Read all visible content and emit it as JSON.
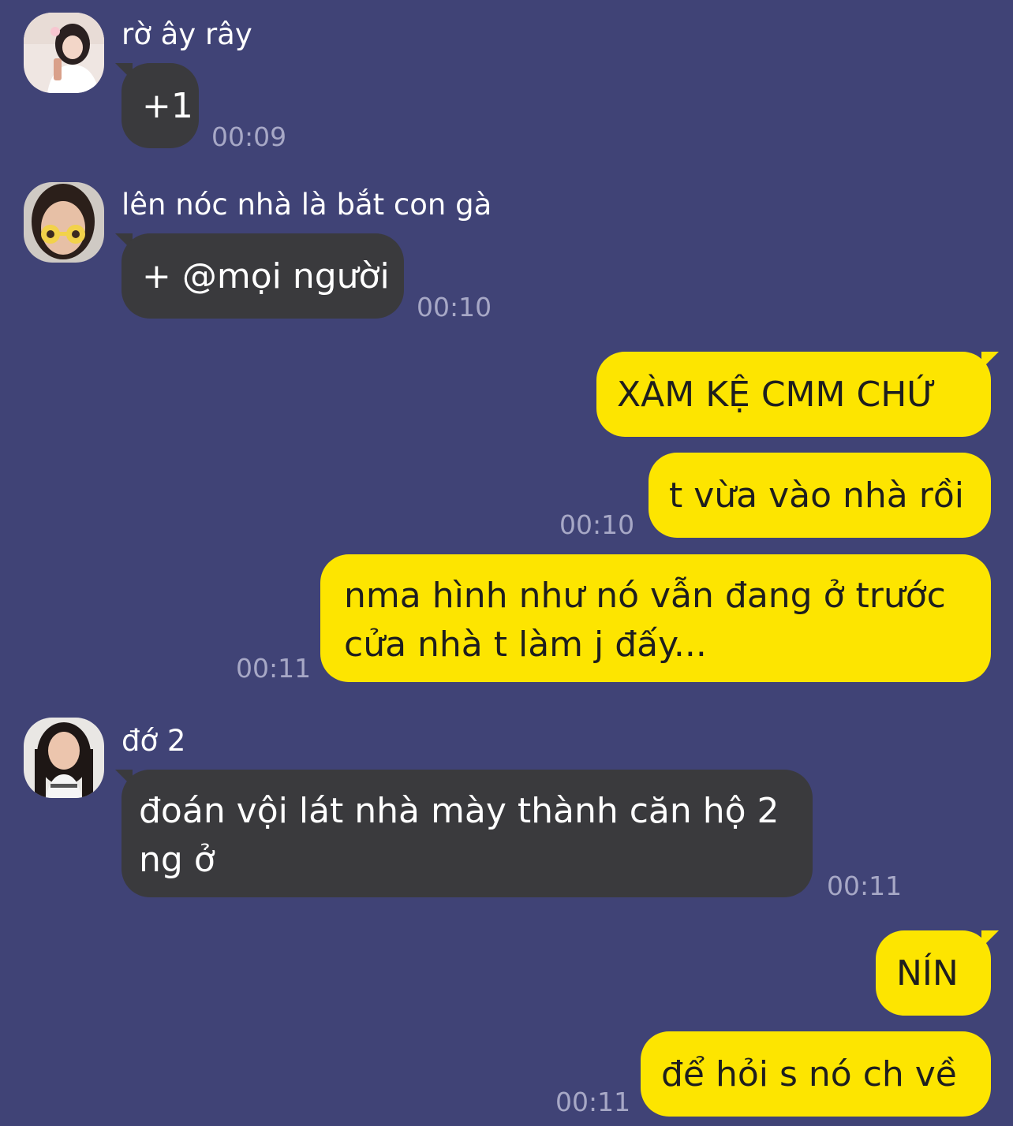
{
  "messages": [
    {
      "sender": "rờ ây rây",
      "text": "+1",
      "time": "00:09",
      "direction": "in"
    },
    {
      "sender": "lên nóc nhà là bắt con gà",
      "text": "+ @mọi người",
      "time": "00:10",
      "direction": "in"
    },
    {
      "text": "XÀM KỆ CMM CHỨ",
      "direction": "out"
    },
    {
      "text": "t vừa vào nhà rồi",
      "time": "00:10",
      "direction": "out"
    },
    {
      "text": "nma hình như nó vẫn đang ở trước cửa nhà t làm j đấy...",
      "time": "00:11",
      "direction": "out"
    },
    {
      "sender": "đớ 2",
      "text": "đoán vội lát nhà mày thành căn hộ 2 ng ở",
      "time": "00:11",
      "direction": "in"
    },
    {
      "text": "NÍN",
      "direction": "out"
    },
    {
      "text": "để hỏi s nó ch về",
      "time": "00:11",
      "direction": "out"
    }
  ],
  "colors": {
    "background": "#404376",
    "incoming_bubble": "#3a3a3d",
    "outgoing_bubble": "#fde500",
    "timestamp": "#a7a8c6"
  }
}
